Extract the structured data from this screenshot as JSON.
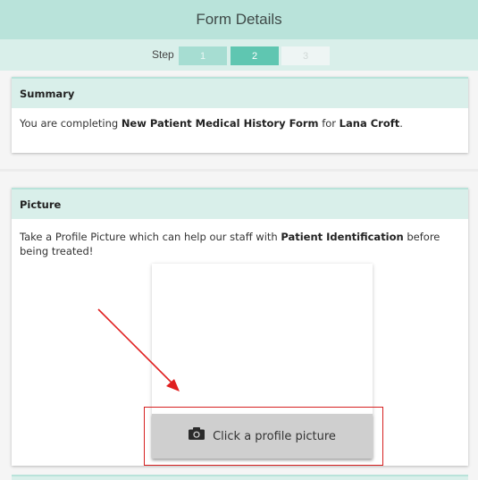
{
  "header": {
    "title": "Form Details"
  },
  "steps": {
    "label": "Step",
    "items": [
      "1",
      "2",
      "3"
    ],
    "active": "2"
  },
  "summary": {
    "title": "Summary",
    "text_prefix": "You are completing ",
    "form_name": "New Patient Medical History Form",
    "text_mid": " for ",
    "patient_name": "Lana Croft",
    "text_suffix": "."
  },
  "picture": {
    "title": "Picture",
    "text_prefix": "Take a Profile Picture which can help our staff with ",
    "text_bold": "Patient Identification",
    "text_suffix": " before being treated!",
    "button_label": "Click a profile picture",
    "button_icon": "camera-icon"
  },
  "annotation": {
    "color": "#d62020"
  },
  "colors": {
    "header_bg": "#b9e3da",
    "accent": "#5fc6b1",
    "card_head_bg": "#d9efea"
  }
}
